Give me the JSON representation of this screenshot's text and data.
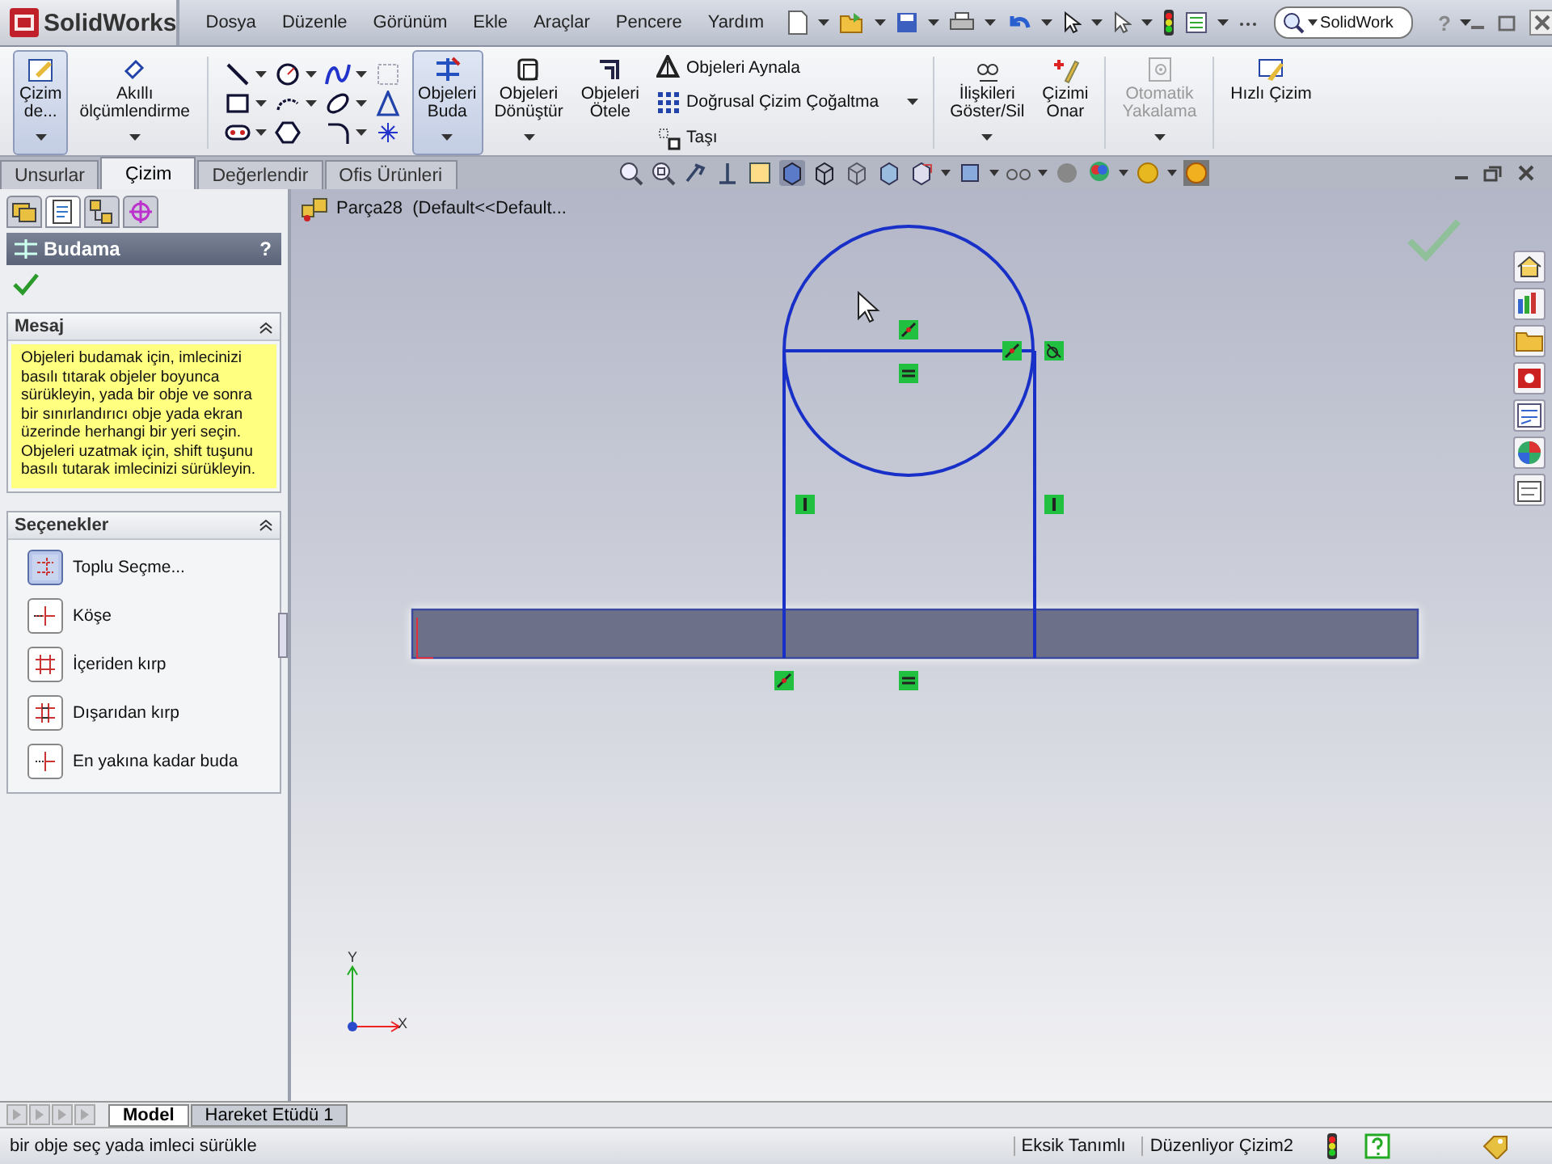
{
  "title_bar": {
    "logo": "SolidWorks",
    "menus": [
      "Dosya",
      "Düzenle",
      "Görünüm",
      "Ekle",
      "Araçlar",
      "Pencere",
      "Yardım"
    ],
    "search": {
      "value": "SolidWork"
    },
    "help": "?"
  },
  "command_manager": [
    {
      "kind": "large",
      "label": "Çizim\nde...",
      "selected": true,
      "disabled": false,
      "has_menu": true
    },
    {
      "kind": "large",
      "label": "Akıllı\nölçümlendirme",
      "selected": false,
      "disabled": false,
      "has_menu": true
    },
    {
      "kind": "tools"
    },
    {
      "kind": "large",
      "label": "Objeleri\nBuda",
      "selected": true,
      "disabled": false,
      "has_menu": true
    },
    {
      "kind": "large",
      "label": "Objeleri\nDönüştür",
      "selected": false,
      "disabled": false,
      "has_menu": true
    },
    {
      "kind": "large",
      "label": "Objeleri\nÖtele",
      "selected": false,
      "disabled": false,
      "has_menu": false
    },
    {
      "kind": "list",
      "items": [
        {
          "label": "Objeleri Aynala",
          "has_menu": false
        },
        {
          "label": "Doğrusal Çizim Çoğaltma",
          "has_menu": true
        },
        {
          "label": "Taşı",
          "has_menu": false
        }
      ]
    },
    {
      "kind": "large",
      "label": "İlişkileri\nGöster/Sil",
      "selected": false,
      "disabled": false,
      "has_menu": true
    },
    {
      "kind": "large",
      "label": "Çizimi\nOnar",
      "selected": false,
      "disabled": false,
      "has_menu": false
    },
    {
      "kind": "large",
      "label": "Otomatik\nYakalama",
      "selected": false,
      "disabled": true,
      "has_menu": true
    },
    {
      "kind": "large",
      "label": "Hızlı Çizim",
      "selected": false,
      "disabled": false,
      "has_menu": false
    }
  ],
  "tabs": [
    {
      "label": "Unsurlar",
      "selected": false
    },
    {
      "label": "Çizim",
      "selected": true
    },
    {
      "label": "Değerlendir",
      "selected": false
    },
    {
      "label": "Ofis Ürünleri",
      "selected": false
    }
  ],
  "property_manager": {
    "tabs": [
      {
        "selected": false
      },
      {
        "selected": true
      },
      {
        "selected": false
      },
      {
        "selected": false
      }
    ],
    "title": "Budama",
    "help": "?",
    "message": {
      "title": "Mesaj",
      "expanded": true,
      "text": "Objeleri budamak için, imlecinizi basılı tıtarak objeler boyunca sürükleyin, yada bir obje ve sonra bir sınırlandırıcı obje yada ekran üzerinde herhangi bir yeri seçin. Objeleri uzatmak için, shift tuşunu basılı tutarak imlecinizi sürükleyin."
    },
    "options": {
      "title": "Seçenekler",
      "expanded": true,
      "items": [
        {
          "label": "Toplu Seçme...",
          "selected": true
        },
        {
          "label": "Köşe",
          "selected": false
        },
        {
          "label": "İçeriden kırp",
          "selected": false
        },
        {
          "label": "Dışarıdan kırp",
          "selected": false
        },
        {
          "label": "En yakına kadar buda",
          "selected": false
        }
      ]
    }
  },
  "graphics": {
    "breadcrumb": "Parça28  (Default<<Default...",
    "axis_labels": [
      "Y",
      "X"
    ]
  },
  "bottom_tabs": [
    {
      "label": "Model",
      "selected": true
    },
    {
      "label": "Hareket Etüdü 1",
      "selected": false
    }
  ],
  "status_bar": {
    "message": "bir obje seç yada imleci sürükle",
    "fields": [
      "Eksik Tanımlı",
      "Düzenliyor Çizim2"
    ]
  }
}
